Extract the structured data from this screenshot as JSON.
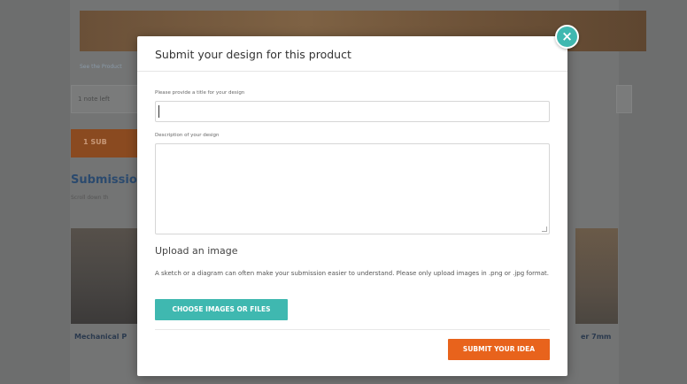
{
  "background": {
    "link_text": "See the Product",
    "hint_text": "1 note left",
    "orange_label": "1   SUB",
    "heading": "Submissio",
    "subtext": "Scroll down th",
    "card_left_title": "Mechanical P",
    "card_right_title": "er 7mm"
  },
  "modal": {
    "title": "Submit your design for this product",
    "close_label": "×",
    "title_field": {
      "label": "Please provide a title for your design",
      "value": "",
      "placeholder": ""
    },
    "description_field": {
      "label": "Description of your design",
      "value": "",
      "placeholder": ""
    },
    "upload": {
      "heading": "Upload an image",
      "description": "A sketch or a diagram can often make your submission easier to understand. Please only upload images in .png or .jpg format.",
      "choose_label": "CHOOSE IMAGES OR FILES"
    },
    "submit_label": "SUBMIT YOUR IDEA"
  },
  "colors": {
    "accent_teal": "#3fb8b0",
    "submit_orange": "#e8631c",
    "overlay": "#6d6e6e"
  }
}
